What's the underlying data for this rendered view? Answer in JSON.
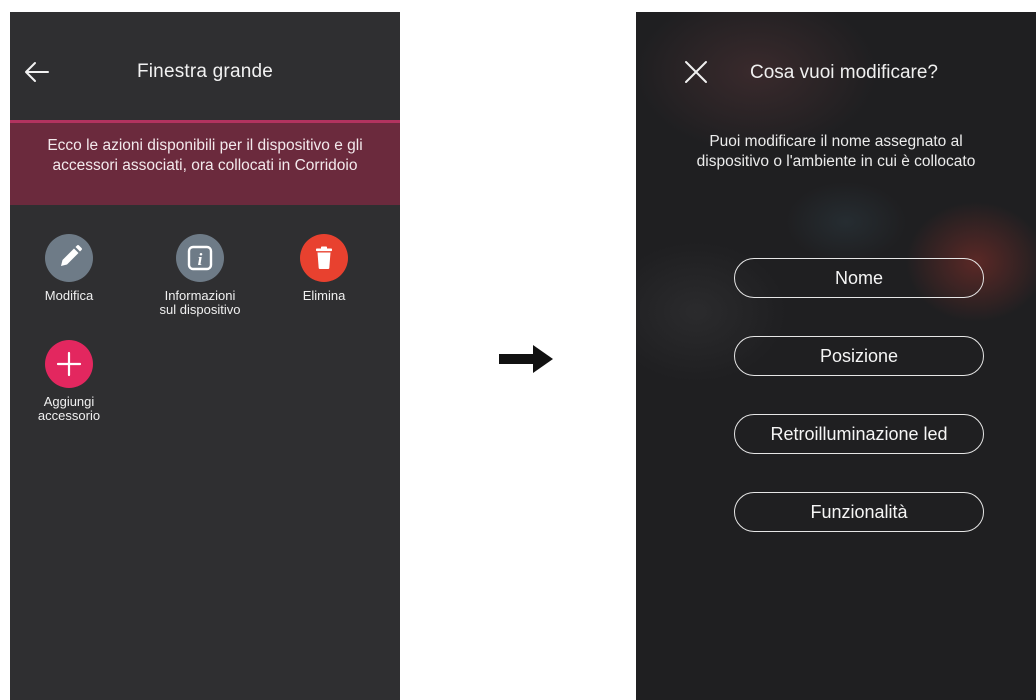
{
  "left_screen": {
    "title": "Finestra grande",
    "back_icon": "arrow-left",
    "banner_text": "Ecco le azioni disponibili per il dispositivo e gli accessori associati, ora collocati in Corridoio",
    "actions": [
      {
        "label": "Modifica",
        "icon": "pencil",
        "color": "#6e7b87"
      },
      {
        "label_line1": "Informazioni",
        "label_line2": "sul dispositivo",
        "icon": "info",
        "color": "#6e7b87"
      },
      {
        "label": "Elimina",
        "icon": "trash",
        "color": "#e8412f"
      },
      {
        "label_line1": "Aggiungi",
        "label_line2": "accessorio",
        "icon": "plus",
        "color": "#e3275f"
      }
    ],
    "accent_color": "#b2335f",
    "banner_color": "#6b2a3d"
  },
  "transition_arrow": "arrow-right",
  "right_screen": {
    "title": "Cosa vuoi modificare?",
    "close_icon": "close-x",
    "subtitle_line1": "Puoi modificare il nome assegnato al",
    "subtitle_line2": "dispositivo o l'ambiente in cui è collocato",
    "options": [
      "Nome",
      "Posizione",
      "Retroilluminazione led",
      "Funzionalità"
    ]
  }
}
